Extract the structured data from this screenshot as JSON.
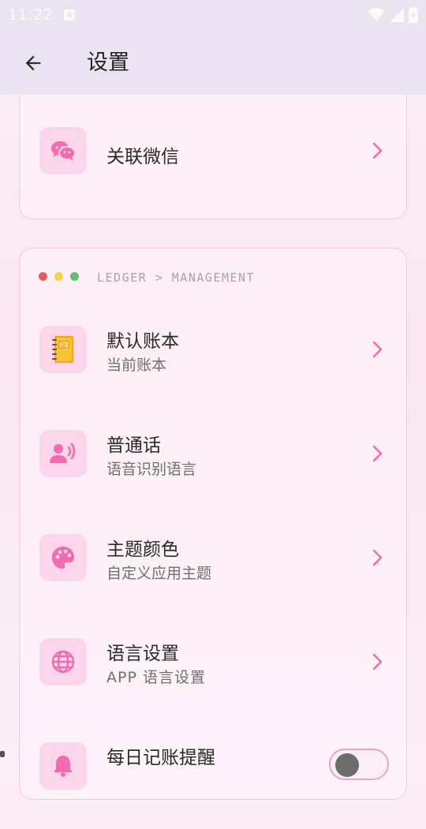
{
  "status_bar": {
    "time": "11:22",
    "notification_glyph": "A"
  },
  "toolbar": {
    "title": "设置",
    "back_icon": "arrow-left-icon"
  },
  "colors": {
    "accent": "#f06bb0",
    "tile_bg": "#fbd5ea",
    "card_border": "#f4c9df",
    "dot_red": "#ef5a5a",
    "dot_yellow": "#f5d547",
    "dot_green": "#5fc06a"
  },
  "top_card": {
    "items": [
      {
        "title": "关联微信",
        "icon": "wechat-icon"
      }
    ]
  },
  "main_card": {
    "breadcrumb": "LEDGER > MANAGEMENT",
    "items": [
      {
        "title": "默认账本",
        "subtitle": "当前账本",
        "icon": "notebook-icon"
      },
      {
        "title": "普通话",
        "subtitle": "语音识别语言",
        "icon": "voice-user-icon"
      },
      {
        "title": "主题颜色",
        "subtitle": "自定义应用主题",
        "icon": "palette-icon"
      },
      {
        "title": "语言设置",
        "subtitle": "APP 语言设置",
        "icon": "globe-icon"
      },
      {
        "title": "每日记账提醒",
        "icon": "bell-icon",
        "toggle_on": false
      }
    ]
  }
}
